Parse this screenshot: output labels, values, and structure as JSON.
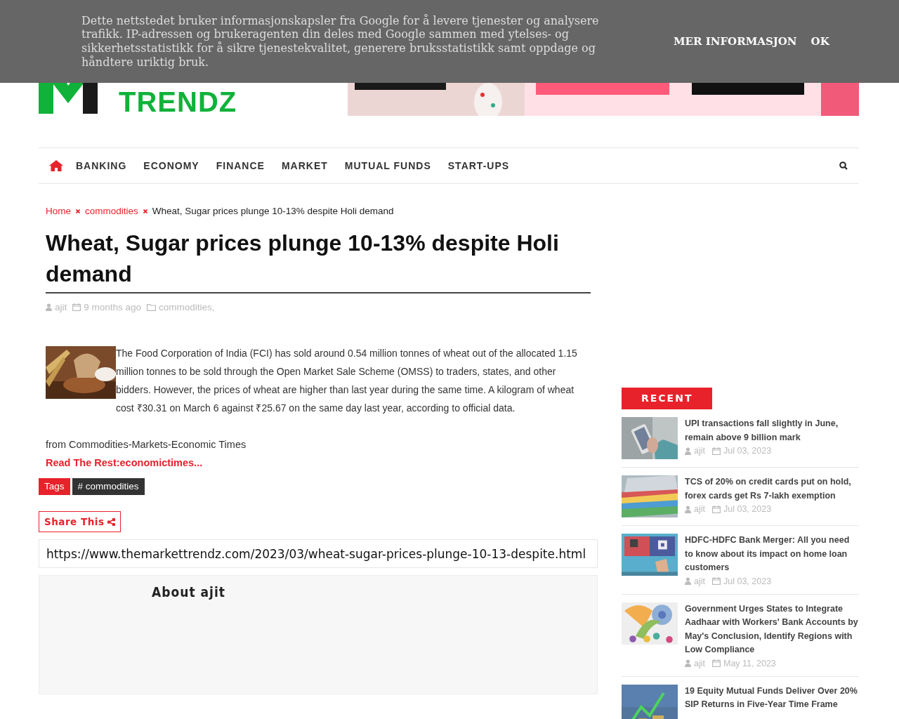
{
  "cookie_notice": {
    "text": "Dette nettstedet bruker informasjonskapsler fra Google for å levere tjenester og analysere trafikk. IP-adressen og brukeragenten din deles med Google sammen med ytelses- og sikkerhetsstatistikk for å sikre tjenestekvalitet, generere bruksstatistikk samt oppdage og håndtere uriktig bruk.",
    "buttons": [
      "MER INFORMASJON",
      "OK"
    ]
  },
  "header": {
    "logo_text": "TRENDZ"
  },
  "nav": {
    "items": [
      "BANKING",
      "ECONOMY",
      "FINANCE",
      "MARKET",
      "MUTUAL FUNDS",
      "START-UPS"
    ]
  },
  "breadcrumb": [
    "Home",
    "commodities",
    "Wheat, Sugar prices plunge 10-13% despite Holi demand"
  ],
  "article": {
    "title": "Wheat, Sugar prices plunge 10-13% despite Holi demand",
    "author": "ajit",
    "time": "9 months ago",
    "category": "commodities,",
    "body": "The Food Corporation of India (FCI) has sold around 0.54 million tonnes of wheat out of the allocated 1.15 million tonnes to be sold through the Open Market Sale Scheme (OMSS) to traders, states, and other bidders. However, the prices of wheat are higher than last year during the same time. A kilogram of wheat cost ₹30.31 on March 6 against ₹25.67 on the same day last year, according to official data.",
    "source": "from Commodities-Markets-Economic Times",
    "read_more": "Read The Rest:economictimes...",
    "tags_label": "Tags",
    "tags": [
      "# commodities"
    ],
    "share_label": "Share This",
    "url": "https://www.themarkettrendz.com/2023/03/wheat-sugar-prices-plunge-10-13-despite.html",
    "about_title": "About ajit"
  },
  "sidebar": {
    "heading": "RECENT",
    "posts": [
      {
        "title": "UPI transactions fall slightly in June, remain above 9 billion mark",
        "author": "ajit",
        "date": "Jul 03, 2023"
      },
      {
        "title": "TCS of 20% on credit cards put on hold, forex cards get Rs 7-lakh exemption",
        "author": "ajit",
        "date": "Jul 03, 2023"
      },
      {
        "title": "HDFC-HDFC Bank Merger: All you need to know about its impact on home loan customers",
        "author": "ajit",
        "date": "Jul 03, 2023"
      },
      {
        "title": "Government Urges States to Integrate Aadhaar with Workers' Bank Accounts by May's Conclusion, Identify Regions with Low Compliance",
        "author": "ajit",
        "date": "May 11, 2023"
      },
      {
        "title": "19 Equity Mutual Funds Deliver Over 20% SIP Returns in Five-Year Time Frame"
      }
    ]
  }
}
